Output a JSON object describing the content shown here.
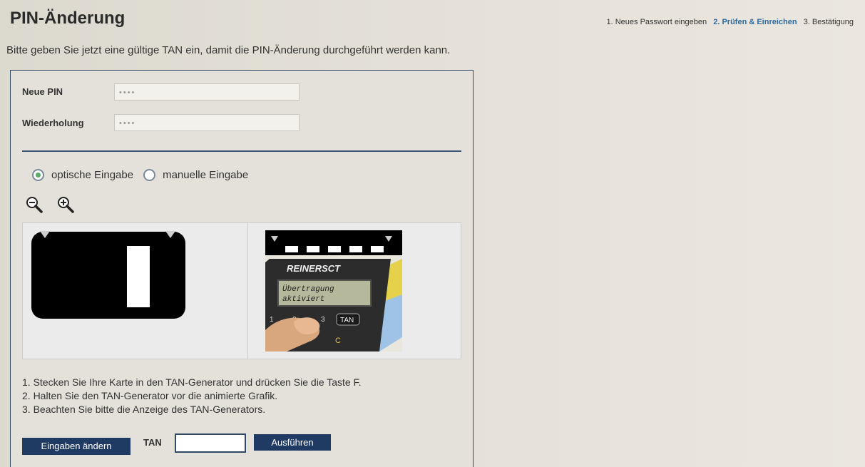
{
  "header": {
    "title": "PIN-Änderung",
    "steps": [
      {
        "label": "1. Neues Passwort eingeben",
        "active": false
      },
      {
        "label": "2. Prüfen & Einreichen",
        "active": true
      },
      {
        "label": "3. Bestätigung",
        "active": false
      }
    ]
  },
  "intro": "Bitte geben Sie jetzt eine gültige TAN ein, damit die PIN-Änderung durchgeführt werden kann.",
  "form": {
    "new_pin_label": "Neue PIN",
    "new_pin_value": "••••",
    "repeat_label": "Wiederholung",
    "repeat_value": "••••"
  },
  "mode": {
    "optical_label": "optische Eingabe",
    "optical_selected": true,
    "manual_label": "manuelle Eingabe",
    "manual_selected": false
  },
  "zoom": {
    "out_icon": "zoom-out-icon",
    "in_icon": "zoom-in-icon"
  },
  "device_display": {
    "line1": "Übertragung",
    "line2": "aktiviert",
    "brand": "REINERSCT"
  },
  "instructions": [
    "1. Stecken Sie Ihre Karte in den TAN-Generator und drücken Sie die Taste F.",
    "2. Halten Sie den TAN-Generator vor die animierte Grafik.",
    "3. Beachten Sie bitte die Anzeige des TAN-Generators."
  ],
  "actions": {
    "change_label": "Eingaben ändern",
    "tan_label": "TAN",
    "tan_value": "",
    "execute_label": "Ausführen"
  },
  "colors": {
    "accent": "#1f3b63",
    "step_active": "#2a6aa0",
    "panel_border": "#2f4a66"
  }
}
